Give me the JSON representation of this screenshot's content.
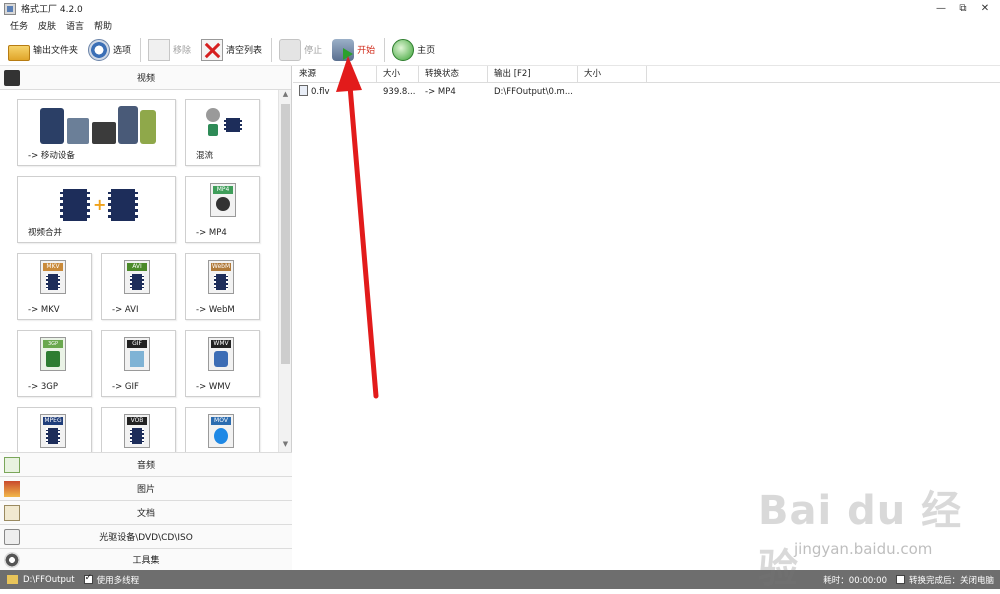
{
  "window": {
    "title": "格式工厂 4.2.0",
    "minimize": "—",
    "restore": "⧉",
    "close": "✕"
  },
  "menu": [
    "任务",
    "皮肤",
    "语言",
    "帮助"
  ],
  "toolbar": {
    "output_folder": "输出文件夹",
    "options": "选项",
    "remove": "移除",
    "clear_list": "清空列表",
    "stop": "停止",
    "start": "开始",
    "home": "主页"
  },
  "left_panel": {
    "video_header": "视频",
    "tiles": [
      {
        "label": "-> 移动设备",
        "icon": "mobile-devices-icon"
      },
      {
        "label": "混流",
        "icon": "mux-icon"
      },
      {
        "label": "视频合并",
        "icon": "video-merge-icon"
      },
      {
        "label": "-> MP4",
        "tag": "MP4",
        "icon": "mp4-file-icon"
      },
      {
        "label": "-> MKV",
        "tag": "MKV",
        "icon": "mkv-file-icon"
      },
      {
        "label": "-> AVI",
        "tag": "AVI",
        "icon": "avi-file-icon"
      },
      {
        "label": "-> WebM",
        "tag": "WebM",
        "icon": "webm-file-icon"
      },
      {
        "label": "-> 3GP",
        "tag": "3GP",
        "icon": "3gp-file-icon"
      },
      {
        "label": "-> GIF",
        "tag": "GIF",
        "icon": "gif-file-icon"
      },
      {
        "label": "-> WMV",
        "tag": "WMV",
        "icon": "wmv-file-icon"
      },
      {
        "label": "",
        "tag": "MPEG",
        "icon": "mpeg-file-icon"
      },
      {
        "label": "",
        "tag": "VOB",
        "icon": "vob-file-icon"
      },
      {
        "label": "",
        "tag": "MOV",
        "icon": "mov-file-icon"
      }
    ],
    "categories": [
      "音频",
      "图片",
      "文档",
      "光驱设备\\DVD\\CD\\ISO",
      "工具集"
    ]
  },
  "file_list": {
    "columns": [
      "来源",
      "大小",
      "转换状态",
      "输出 [F2]",
      "大小"
    ],
    "rows": [
      {
        "source": "0.flv",
        "size": "939.8...",
        "status": "-> MP4",
        "output": "D:\\FFOutput\\0.m...",
        "out_size": ""
      }
    ]
  },
  "statusbar": {
    "output_path": "D:\\FFOutput",
    "multithread_label": "使用多线程",
    "multithread_checked": true,
    "elapsed_label": "耗时：00:00:00",
    "after_convert_label": "转换完成后：关闭电脑",
    "after_convert_checked": false
  },
  "watermark": {
    "main": "Bai du 经验",
    "sub": "jingyan.baidu.com"
  },
  "colors": {
    "arrow": "#e21b1b",
    "start_label": "#d12a1a",
    "statusbar": "#6e6e6e"
  }
}
